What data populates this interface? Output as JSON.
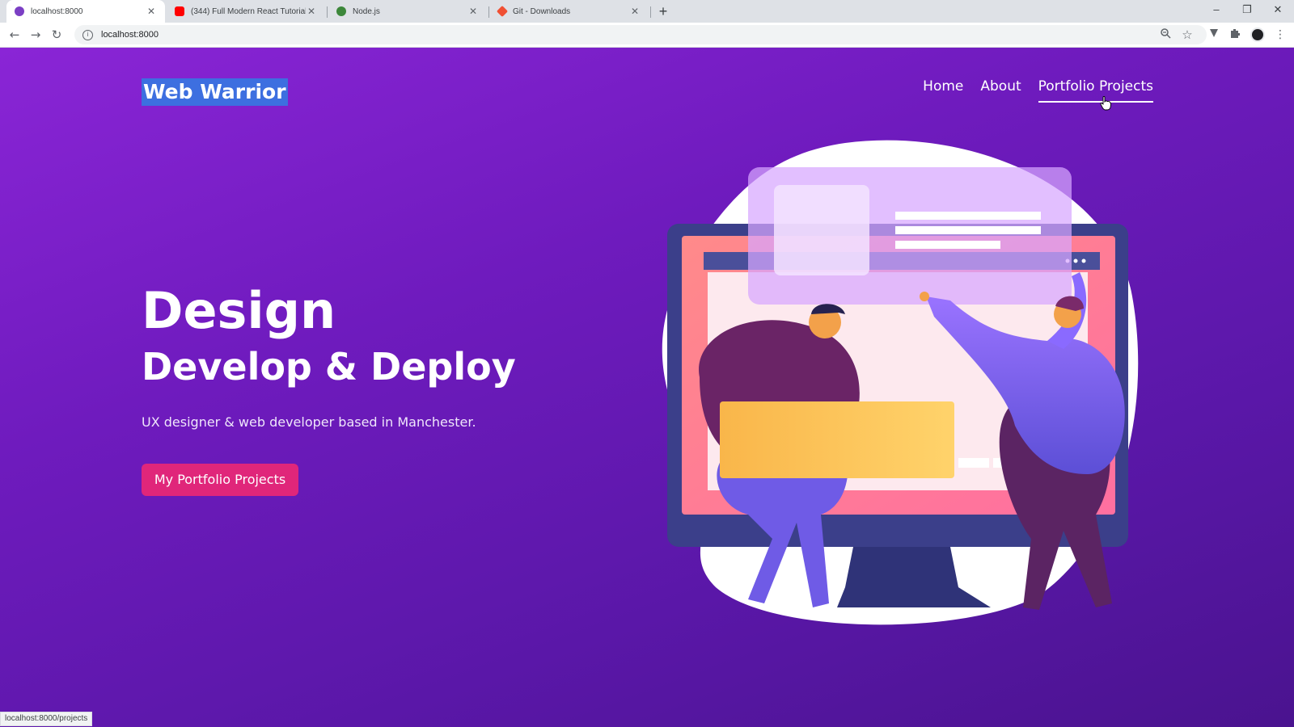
{
  "browser": {
    "tabs": [
      {
        "title": "localhost:8000",
        "active": true,
        "favicon_color": "#7b3fc4"
      },
      {
        "title": "(344) Full Modern React Tutorial",
        "active": false,
        "favicon_color": "#ff0000"
      },
      {
        "title": "Node.js",
        "active": false,
        "favicon_color": "#3c873a"
      },
      {
        "title": "Git - Downloads",
        "active": false,
        "favicon_color": "#f05033"
      }
    ],
    "address": "localhost:8000",
    "status_url": "localhost:8000/projects"
  },
  "site": {
    "logo": "Web Warrior",
    "nav": [
      {
        "label": "Home",
        "active": false
      },
      {
        "label": "About",
        "active": false
      },
      {
        "label": "Portfolio Projects",
        "active": true
      }
    ]
  },
  "hero": {
    "title": "Design",
    "subtitle": "Develop & Deploy",
    "text": "UX designer & web developer based in Manchester.",
    "cta": "My Portfolio Projects"
  },
  "colors": {
    "accent": "#e0267a",
    "logo_highlight": "#3d6fe0",
    "background_top": "#8a25d6",
    "background_bottom": "#4a138f"
  },
  "icons": {
    "back": "arrow-left-icon",
    "forward": "arrow-right-icon",
    "reload": "reload-icon",
    "info": "info-icon",
    "zoom": "zoom-icon",
    "star": "star-icon",
    "extensions": "puzzle-icon"
  }
}
